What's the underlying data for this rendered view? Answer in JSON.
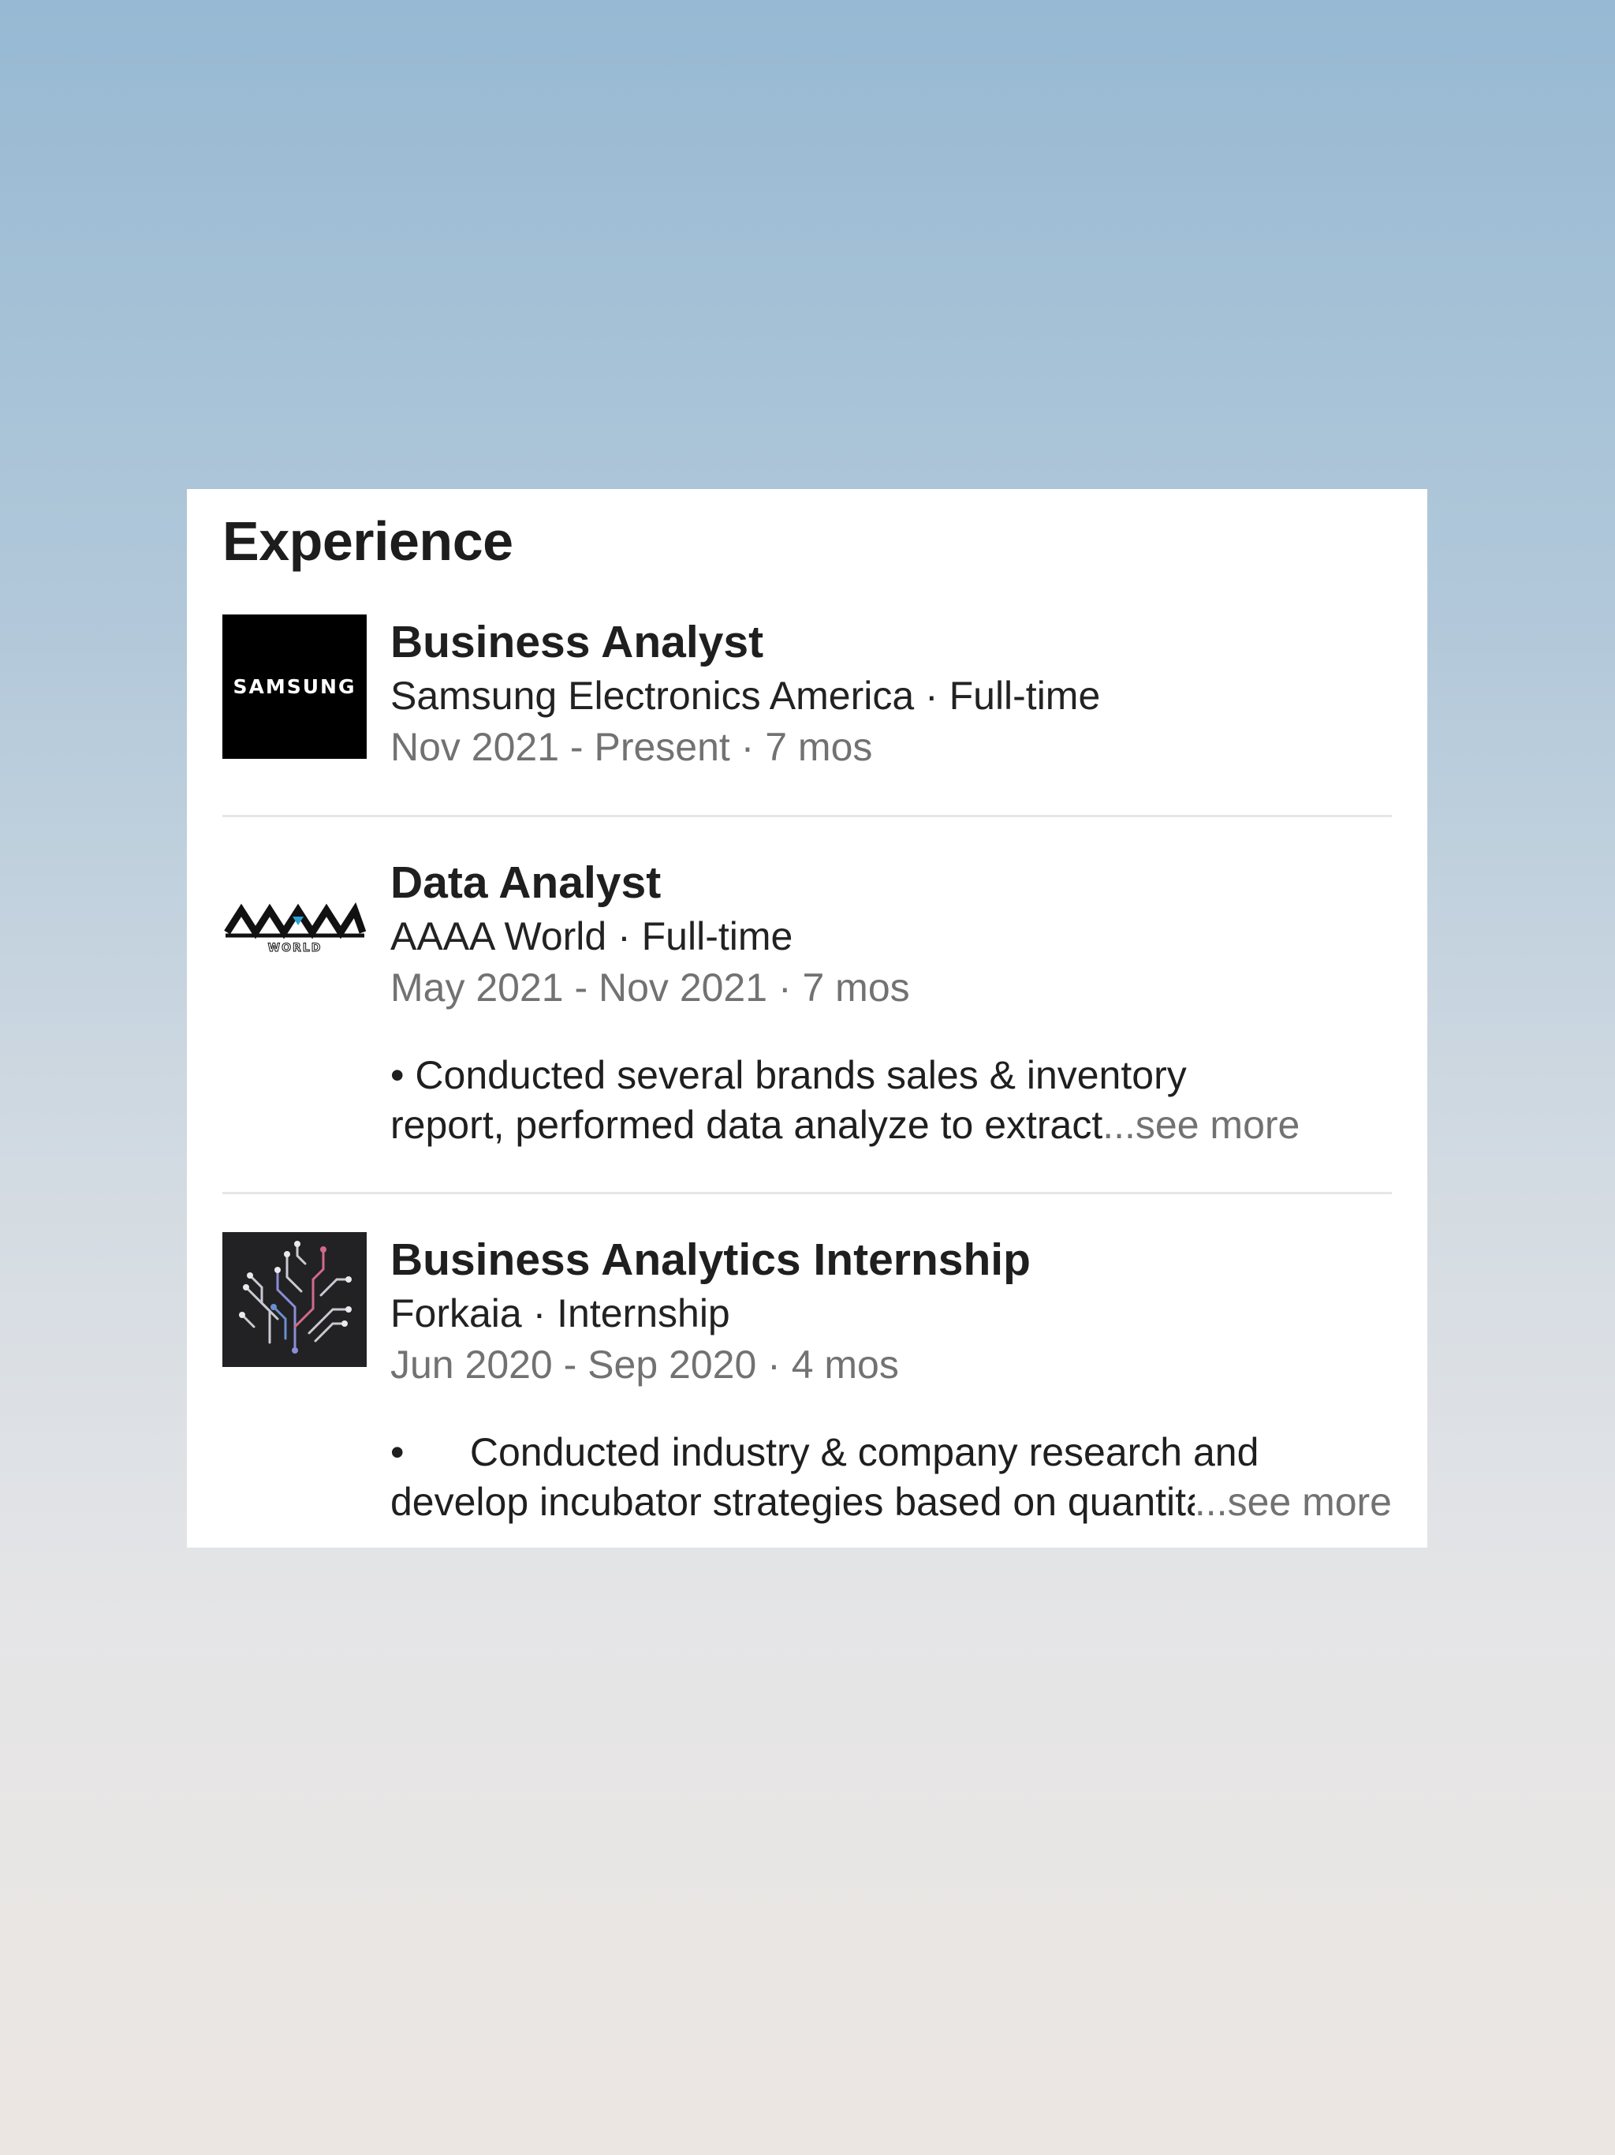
{
  "section": {
    "title": "Experience"
  },
  "experiences": [
    {
      "title": "Business Analyst",
      "company_line": "Samsung Electronics America · Full-time",
      "dates": "Nov 2021 - Present · 7 mos",
      "logo_text": "SAMSUNG"
    },
    {
      "title": "Data Analyst",
      "company_line": "AAAA World · Full-time",
      "dates": "May 2021 - Nov 2021 · 7 mos",
      "desc_line1": "• Conducted several brands sales & inventory",
      "desc_line2": "report, performed data analyze to extract",
      "see_more": "...see more",
      "logo_text": "WORLD"
    },
    {
      "title": "Business Analytics Internship",
      "company_line": "Forkaia · Internship",
      "dates": "Jun 2020 - Sep 2020 · 4 mos",
      "desc_line1": "•      Conducted industry & company research and",
      "desc_line2": "develop incubator strategies based on quantitative",
      "see_more": "...see more"
    }
  ],
  "colors": {
    "background_top": "#97b9d3",
    "background_bottom": "#ece6e2",
    "card": "#ffffff",
    "primary_text": "#1f1f1f",
    "secondary_text": "#727272",
    "divider": "#e6e6e6"
  },
  "icons": {
    "samsung": "samsung-logo-icon",
    "aaaa": "aaaa-world-logo-icon",
    "forkaia": "forkaia-circuit-logo-icon"
  }
}
